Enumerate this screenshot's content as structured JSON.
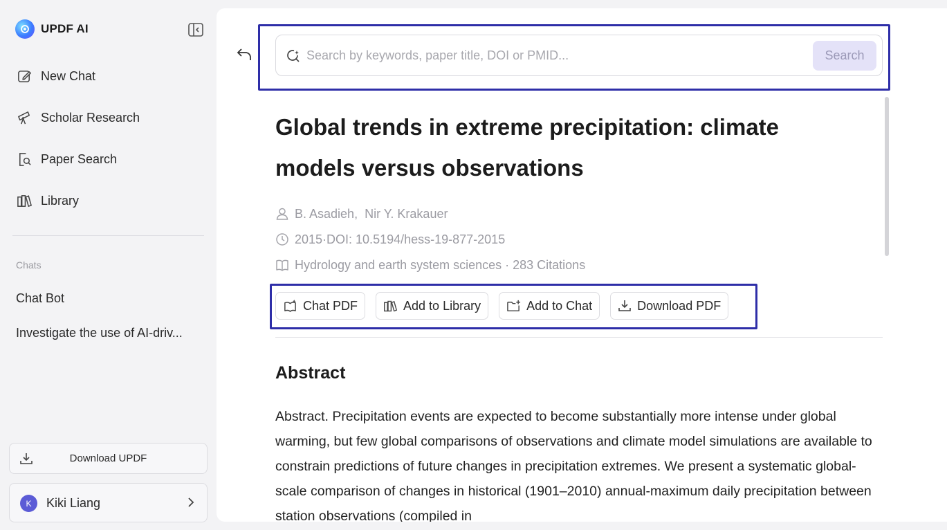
{
  "sidebar": {
    "brand": "UPDF AI",
    "nav": [
      {
        "label": "New Chat",
        "icon": "edit-icon"
      },
      {
        "label": "Scholar Research",
        "icon": "telescope-icon"
      },
      {
        "label": "Paper Search",
        "icon": "doc-search-icon"
      },
      {
        "label": "Library",
        "icon": "library-icon"
      }
    ],
    "chats_label": "Chats",
    "chats": [
      "Chat Bot",
      "Investigate the use of AI-driv..."
    ],
    "download_label": "Download UPDF",
    "user": {
      "initial": "K",
      "name": "Kiki Liang"
    }
  },
  "search": {
    "placeholder": "Search by keywords, paper title, DOI or PMID...",
    "button_label": "Search"
  },
  "paper": {
    "title": "Global trends in extreme precipitation: climate models versus observations",
    "authors": "B. Asadieh,  Nir Y. Krakauer",
    "date_doi": "2015·DOI: 10.5194/hess-19-877-2015",
    "journal_citations": "Hydrology and earth system sciences · 283 Citations"
  },
  "actions": {
    "chat_pdf": "Chat PDF",
    "add_library": "Add to Library",
    "add_chat": "Add to Chat",
    "download_pdf": "Download PDF"
  },
  "abstract": {
    "heading": "Abstract",
    "text": "Abstract. Precipitation events are expected to become substantially more intense under global warming, but few global comparisons of observations and climate model simulations are available to constrain predictions of future changes in precipitation extremes. We present a systematic global-scale comparison of changes in historical (1901–2010) annual-maximum daily precipitation between station observations (compiled in"
  },
  "colors": {
    "accent": "#2e2ea8",
    "search_button_bg": "#e4e2f8"
  }
}
